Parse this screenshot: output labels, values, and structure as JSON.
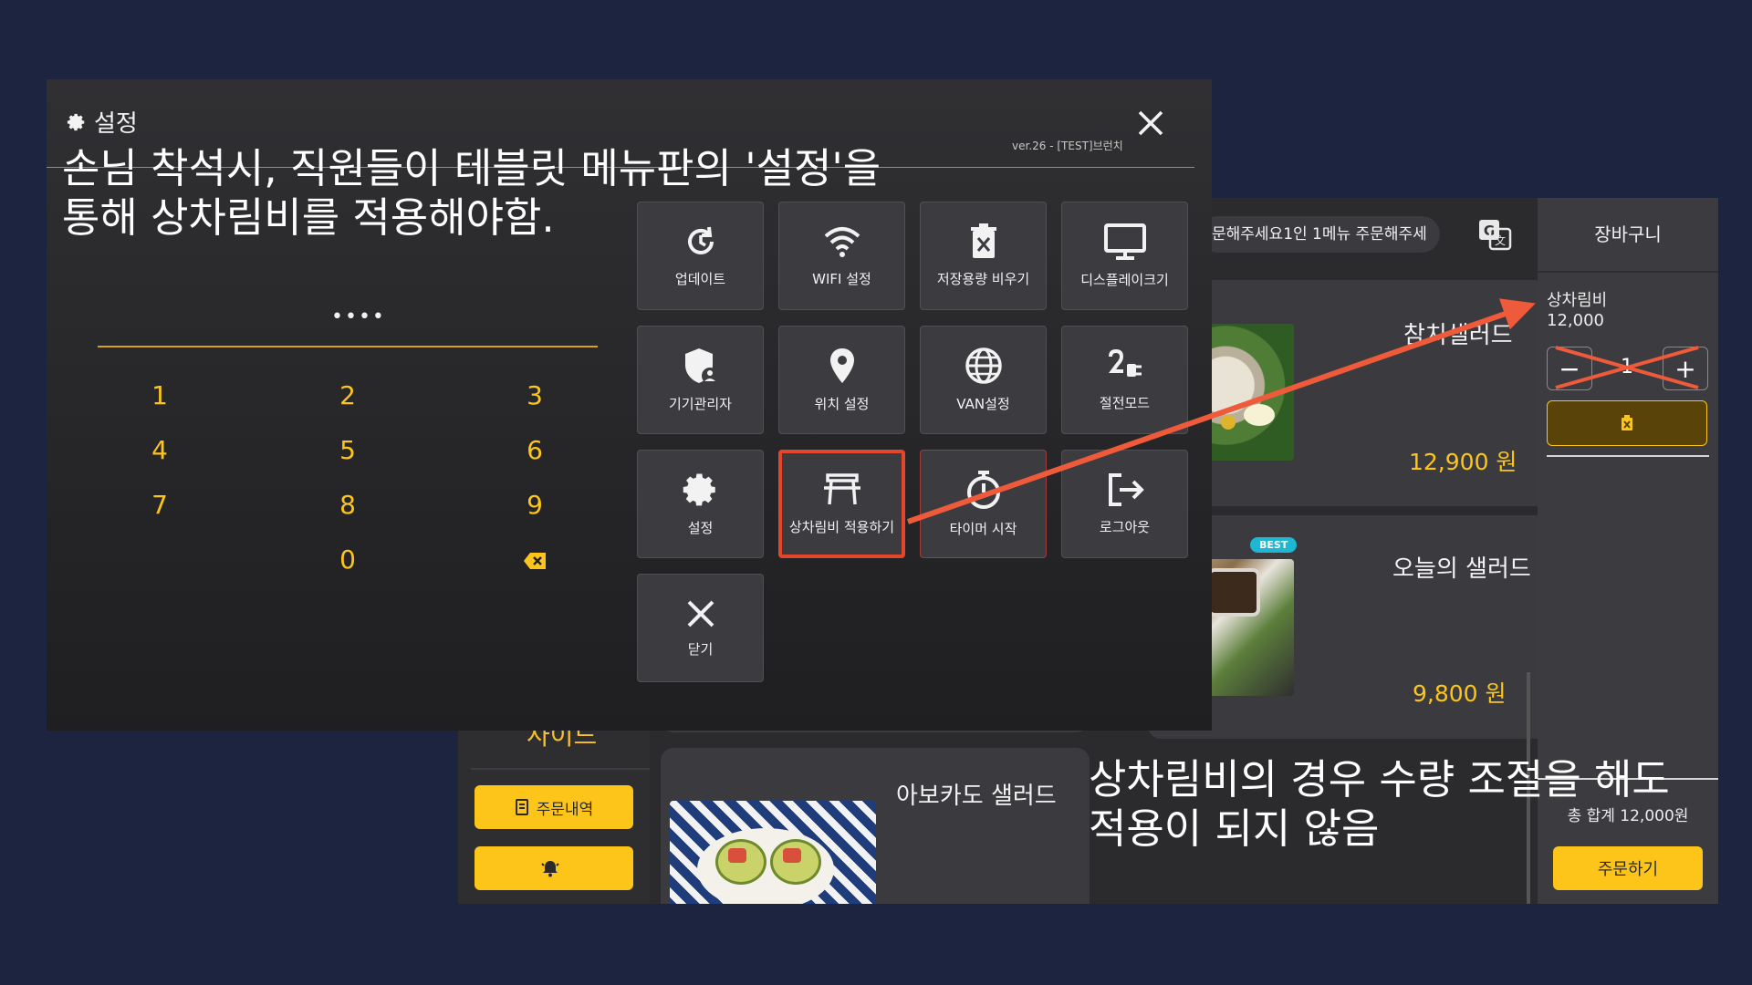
{
  "kiosk": {
    "category_peek": "사이드",
    "order_history_label": "주문내역",
    "banner_text": "문해주세요1인 1메뉴 주문해주세",
    "menu_items": [
      {
        "name": "참치샐러드",
        "price": "12,900 원"
      },
      {
        "name": "오늘의 샐러드",
        "price": "9,800 원",
        "badge": "BEST"
      },
      {
        "name": "아보카도 샐러드"
      }
    ],
    "cart": {
      "title": "장바구니",
      "item_name": "상차림비",
      "item_price": "12,000",
      "quantity": "1",
      "minus": "−",
      "plus": "+",
      "total": "총 합계 12,000원",
      "checkout_label": "주문하기"
    }
  },
  "settings": {
    "title": "설정",
    "version": "ver.26 - [TEST]브런치",
    "pin_display": "••••",
    "keypad": [
      "1",
      "2",
      "3",
      "4",
      "5",
      "6",
      "7",
      "8",
      "9",
      "0"
    ],
    "tiles": [
      {
        "label": "업데이트",
        "icon": "update-icon"
      },
      {
        "label": "WIFI 설정",
        "icon": "wifi-icon"
      },
      {
        "label": "저장용량 비우기",
        "icon": "trash-icon"
      },
      {
        "label": "디스플레이크기",
        "icon": "monitor-icon"
      },
      {
        "label": "기기관리자",
        "icon": "shield-user-icon"
      },
      {
        "label": "위치 설정",
        "icon": "location-pin-icon"
      },
      {
        "label": "VAN설정",
        "icon": "globe-icon"
      },
      {
        "label": "절전모드",
        "icon": "power-plug-icon"
      },
      {
        "label": "설정",
        "icon": "gear-icon"
      },
      {
        "label": "상차림비 적용하기",
        "icon": "table-icon"
      },
      {
        "label": "타이머 시작",
        "icon": "timer-icon"
      },
      {
        "label": "로그아웃",
        "icon": "logout-icon"
      },
      {
        "label": "닫기",
        "icon": "close-icon"
      }
    ]
  },
  "annotations": {
    "line1": "손님 착석시, 직원들이 테블릿 메뉴판의 '설정'을",
    "line2": "통해 상차림비를 적용해야함.",
    "line3": "상차림비의 경우 수량 조절을 해도",
    "line4": "적용이 되지 않음"
  },
  "colors": {
    "background": "#1d2440",
    "accent_yellow": "#fdc51a",
    "highlight_red": "#e3472b",
    "arrow": "#ee5a3a"
  }
}
